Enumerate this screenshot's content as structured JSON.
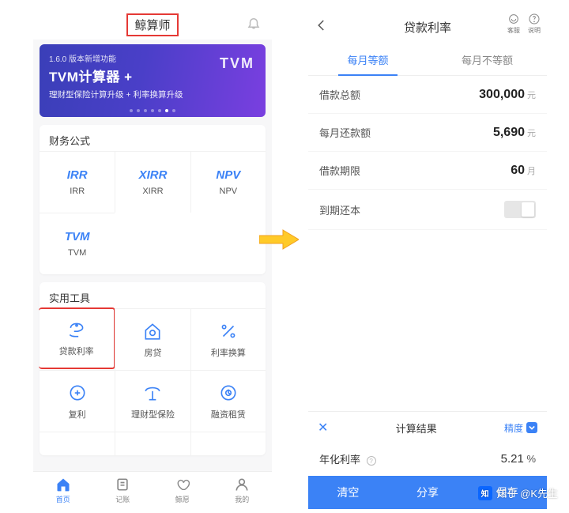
{
  "left": {
    "app_title": "鲸算师",
    "banner": {
      "subtitle": "1.6.0 版本新增功能",
      "title": "TVM计算器 +",
      "desc": "理财型保险计算升级 + 利率换算升级",
      "badge": "TVM"
    },
    "section_finance": "财务公式",
    "finance_items": [
      "IRR",
      "XIRR",
      "NPV",
      "TVM"
    ],
    "section_tools": "实用工具",
    "tool_items": [
      "贷款利率",
      "房贷",
      "利率换算",
      "复利",
      "理财型保险",
      "融资租赁"
    ],
    "tabs": [
      "首页",
      "记账",
      "鲸愿",
      "我的"
    ]
  },
  "right": {
    "title": "贷款利率",
    "header_icons": [
      "客服",
      "说明"
    ],
    "seg": [
      "每月等额",
      "每月不等额"
    ],
    "rows": {
      "principal_label": "借款总额",
      "principal_value": "300,000",
      "principal_unit": "元",
      "monthly_label": "每月还款额",
      "monthly_value": "5,690",
      "monthly_unit": "元",
      "term_label": "借款期限",
      "term_value": "60",
      "term_unit": "月",
      "balloon_label": "到期还本"
    },
    "result": {
      "header": "计算结果",
      "precision": "精度",
      "rate_label": "年化利率",
      "rate_value": "5.21",
      "rate_unit": "%"
    },
    "buttons": [
      "清空",
      "分享",
      "保存"
    ]
  },
  "watermark": "知乎 @K先生"
}
